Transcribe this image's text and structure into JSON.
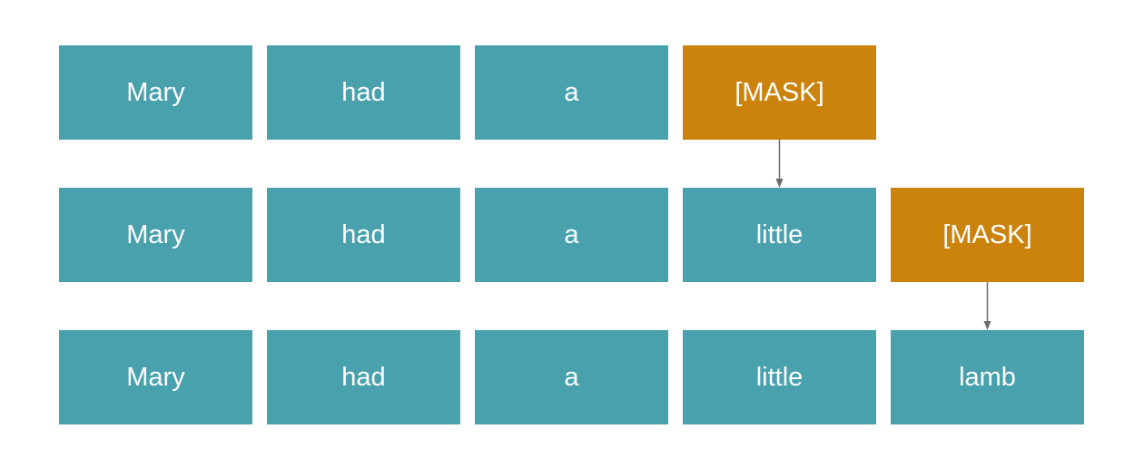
{
  "colors": {
    "token": "#48a1ad",
    "mask": "#cb830e",
    "arrow": "#6b6b6b",
    "text": "#ffffff"
  },
  "rows": [
    {
      "tokens": [
        {
          "label": "Mary",
          "type": "word"
        },
        {
          "label": "had",
          "type": "word"
        },
        {
          "label": "a",
          "type": "word"
        },
        {
          "label": "[MASK]",
          "type": "mask"
        }
      ]
    },
    {
      "tokens": [
        {
          "label": "Mary",
          "type": "word"
        },
        {
          "label": "had",
          "type": "word"
        },
        {
          "label": "a",
          "type": "word"
        },
        {
          "label": "little",
          "type": "word"
        },
        {
          "label": "[MASK]",
          "type": "mask"
        }
      ]
    },
    {
      "tokens": [
        {
          "label": "Mary",
          "type": "word"
        },
        {
          "label": "had",
          "type": "word"
        },
        {
          "label": "a",
          "type": "word"
        },
        {
          "label": "little",
          "type": "word"
        },
        {
          "label": "lamb",
          "type": "word"
        }
      ]
    }
  ],
  "arrows": [
    {
      "from_row": 0,
      "to_row": 1,
      "column": 3
    },
    {
      "from_row": 1,
      "to_row": 2,
      "column": 4
    }
  ]
}
